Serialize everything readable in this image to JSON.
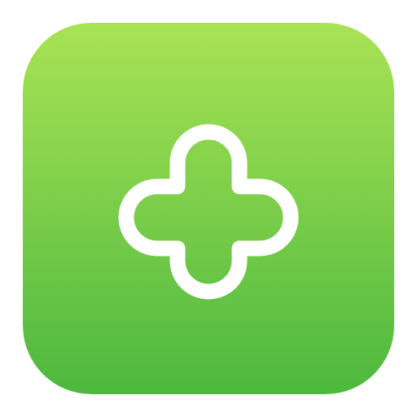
{
  "app_icon": {
    "glyph": "cross-clover-outline",
    "background_gradient": {
      "top": "#A9E355",
      "bottom": "#4DB83E"
    },
    "glyph_color": "#FFFFFF"
  }
}
